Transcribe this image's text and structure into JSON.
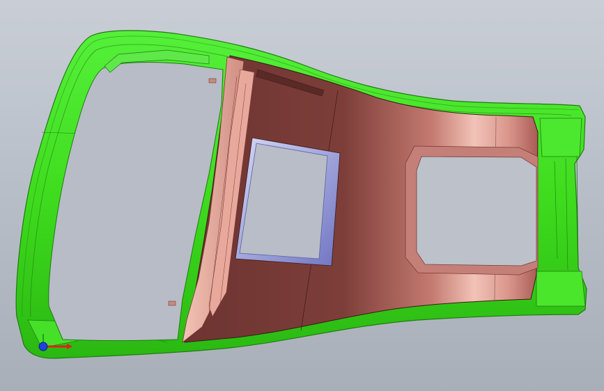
{
  "viewport": {
    "background_top": "#c9ced6",
    "background_bottom": "#a9afb9"
  },
  "model": {
    "parts": [
      {
        "id": "bezel-frame",
        "color": "#3fdc1e",
        "edge_color": "#1f7a10"
      },
      {
        "id": "console-panel",
        "color": "#7a3a36",
        "highlight": "#f0b3a6",
        "edge_color": "#3b1a18"
      },
      {
        "id": "window-trim",
        "color": "#8a90d8",
        "edge_color": "#5a5fa0"
      }
    ]
  },
  "triad": {
    "x_axis_color": "#e0201c",
    "y_axis_color": "#1e9b2a",
    "z_axis_color": "#1f3fe0"
  }
}
